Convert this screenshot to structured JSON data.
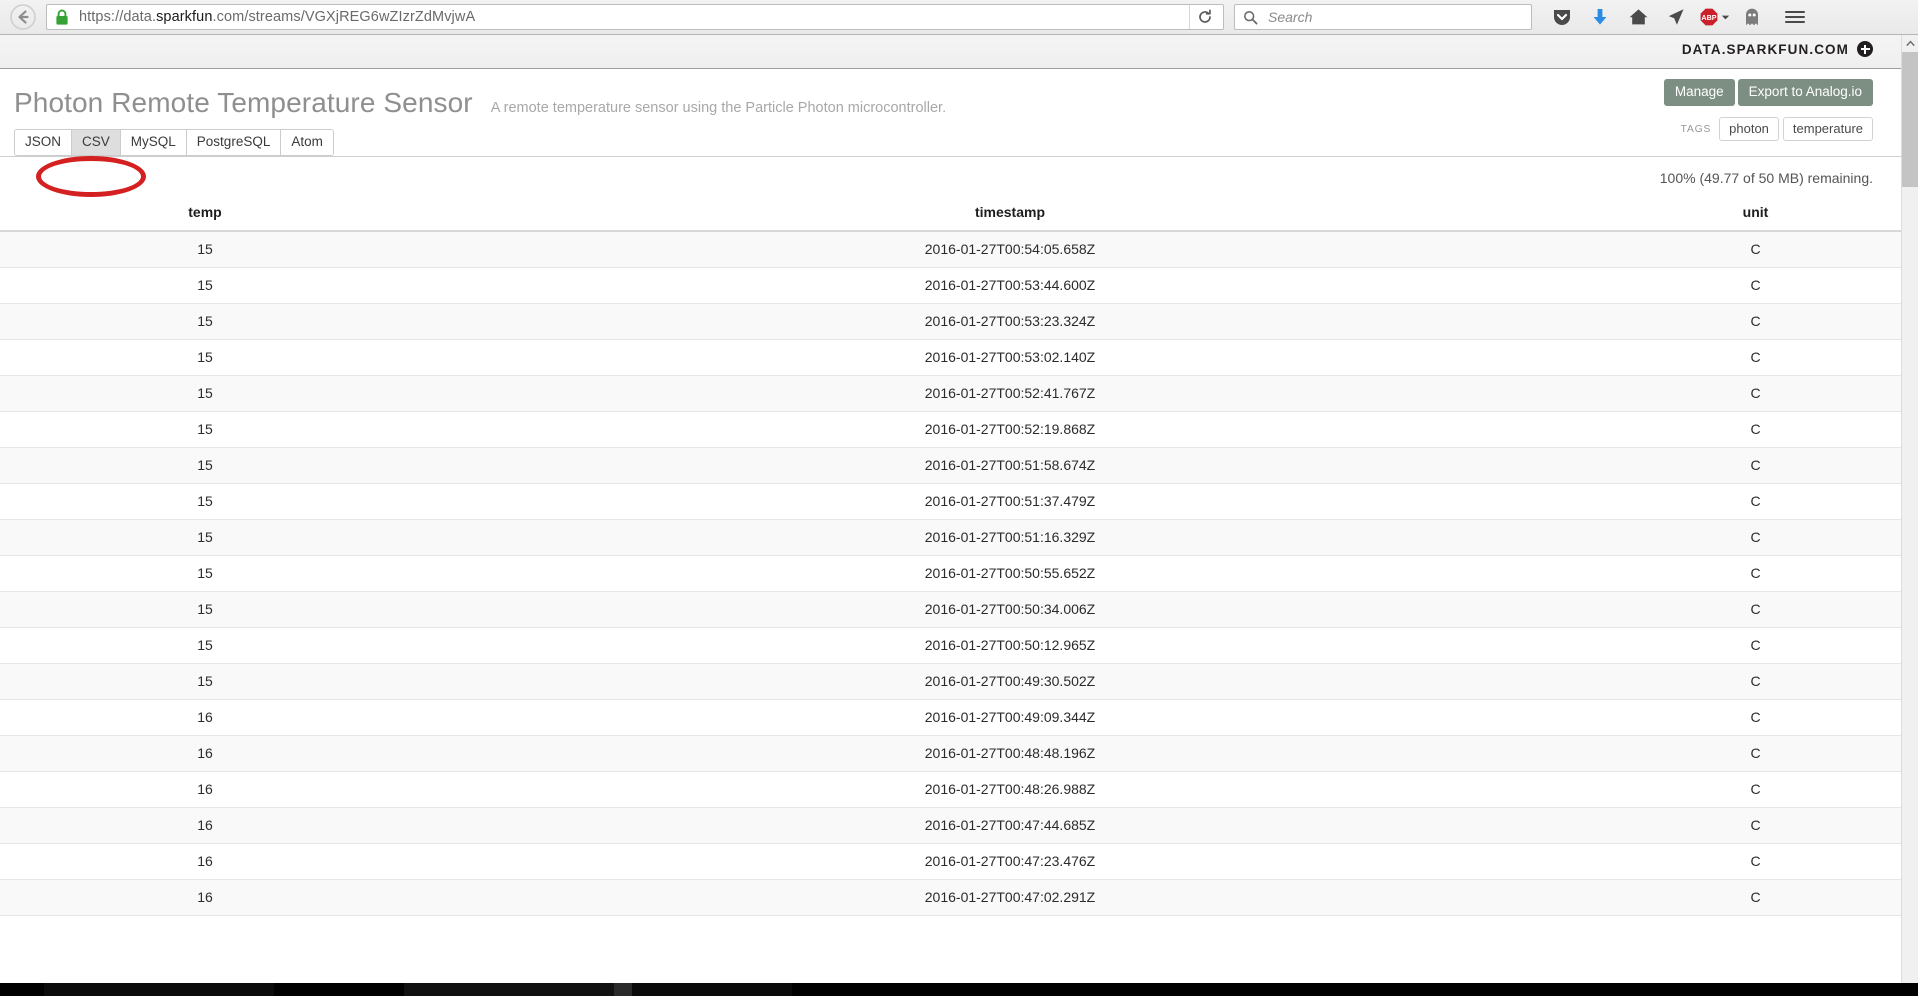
{
  "browser": {
    "back_icon": "back-arrow-icon",
    "lock_icon": "padlock-icon",
    "url": "https://data.sparkfun.com/streams/VGXjREG6wZIzrZdMvjwA",
    "url_scheme": "https://data.",
    "url_host_strong": "sparkfun",
    "url_rest": ".com/streams/VGXjREG6wZIzrZdMvjwA",
    "reload_icon": "reload-icon",
    "search": {
      "placeholder": "Search",
      "value": "",
      "icon": "search-icon"
    },
    "toolbar_icons": [
      {
        "name": "pocket-icon",
        "label": "Pocket"
      },
      {
        "name": "downloads-icon",
        "label": "Downloads"
      },
      {
        "name": "home-icon",
        "label": "Home"
      },
      {
        "name": "send-tab-icon",
        "label": "Send Tab"
      },
      {
        "name": "adblock-plus-icon",
        "label": "ABP"
      },
      {
        "name": "ghostery-icon",
        "label": "Ghostery"
      }
    ],
    "menu_icon": "hamburger-menu-icon"
  },
  "brand": {
    "name": "DATA.SPARKFUN.COM",
    "mark_icon": "sparkfun-plus-icon"
  },
  "header": {
    "title": "Photon Remote Temperature Sensor",
    "subtitle": "A remote temperature sensor using the Particle Photon microcontroller.",
    "format_tabs": [
      {
        "label": "JSON",
        "active": false
      },
      {
        "label": "CSV",
        "active": true
      },
      {
        "label": "MySQL",
        "active": false
      },
      {
        "label": "PostgreSQL",
        "active": false
      },
      {
        "label": "Atom",
        "active": false
      }
    ],
    "buttons": [
      {
        "label": "Manage"
      },
      {
        "label": "Export to Analog.io"
      }
    ],
    "tags_label": "TAGS",
    "tags": [
      "photon",
      "temperature"
    ]
  },
  "storage": {
    "text": "100% (49.77 of 50 MB) remaining."
  },
  "table": {
    "columns": [
      "temp",
      "timestamp",
      "unit"
    ],
    "rows": [
      [
        "15",
        "2016-01-27T00:54:05.658Z",
        "C"
      ],
      [
        "15",
        "2016-01-27T00:53:44.600Z",
        "C"
      ],
      [
        "15",
        "2016-01-27T00:53:23.324Z",
        "C"
      ],
      [
        "15",
        "2016-01-27T00:53:02.140Z",
        "C"
      ],
      [
        "15",
        "2016-01-27T00:52:41.767Z",
        "C"
      ],
      [
        "15",
        "2016-01-27T00:52:19.868Z",
        "C"
      ],
      [
        "15",
        "2016-01-27T00:51:58.674Z",
        "C"
      ],
      [
        "15",
        "2016-01-27T00:51:37.479Z",
        "C"
      ],
      [
        "15",
        "2016-01-27T00:51:16.329Z",
        "C"
      ],
      [
        "15",
        "2016-01-27T00:50:55.652Z",
        "C"
      ],
      [
        "15",
        "2016-01-27T00:50:34.006Z",
        "C"
      ],
      [
        "15",
        "2016-01-27T00:50:12.965Z",
        "C"
      ],
      [
        "15",
        "2016-01-27T00:49:30.502Z",
        "C"
      ],
      [
        "16",
        "2016-01-27T00:49:09.344Z",
        "C"
      ],
      [
        "16",
        "2016-01-27T00:48:48.196Z",
        "C"
      ],
      [
        "16",
        "2016-01-27T00:48:26.988Z",
        "C"
      ],
      [
        "16",
        "2016-01-27T00:47:44.685Z",
        "C"
      ],
      [
        "16",
        "2016-01-27T00:47:23.476Z",
        "C"
      ],
      [
        "16",
        "2016-01-27T00:47:02.291Z",
        "C"
      ]
    ]
  },
  "annotation": {
    "shape": "ellipse",
    "color": "#d42020",
    "target": "CSV"
  },
  "colors": {
    "accent_button": "#7d8f82",
    "annotation_red": "#d42020",
    "lock_green": "#3aae3a",
    "abp_red": "#c9202a",
    "download_blue": "#2b8ce6"
  }
}
